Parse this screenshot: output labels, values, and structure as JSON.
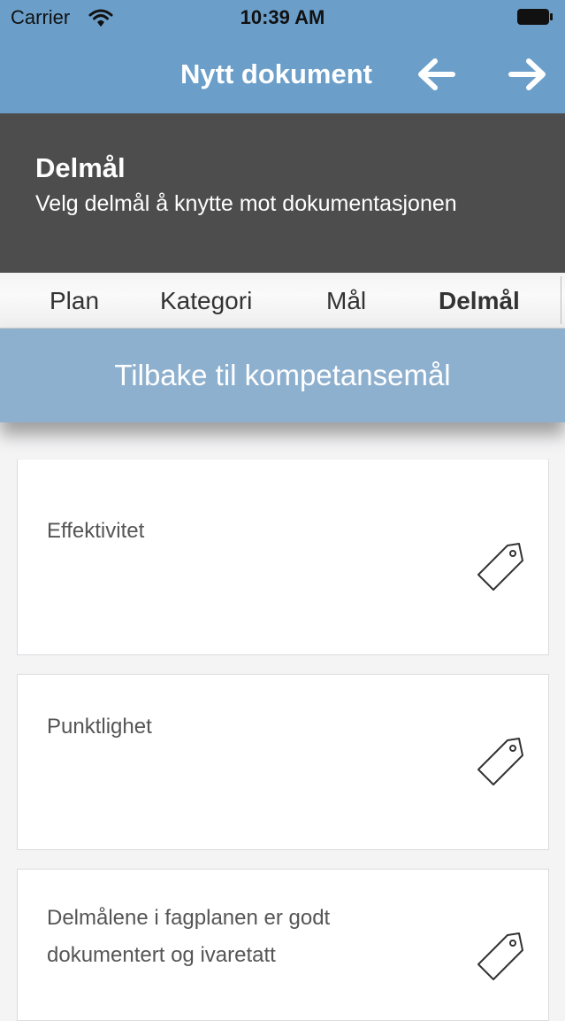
{
  "status_bar": {
    "carrier": "Carrier",
    "time": "10:39 AM"
  },
  "nav": {
    "title": "Nytt dokument",
    "back_icon": "arrow-left-icon",
    "forward_icon": "arrow-right-icon"
  },
  "header": {
    "title": "Delmål",
    "subtitle": "Velg delmål å knytte mot dokumentasjonen"
  },
  "tabs": [
    {
      "label": "Plan",
      "active": false
    },
    {
      "label": "Kategori",
      "active": false
    },
    {
      "label": "Mål",
      "active": false
    },
    {
      "label": "Delmål",
      "active": true
    }
  ],
  "back_banner": {
    "label": "Tilbake til kompetansemål"
  },
  "items": [
    {
      "label": "Effektivitet",
      "icon": "tag-icon"
    },
    {
      "label": "Punktlighet",
      "icon": "tag-icon"
    },
    {
      "label": "Delmålene i fagplanen er godt dokumentert og ivaretatt",
      "icon": "tag-icon"
    }
  ],
  "colors": {
    "nav_bg": "#6b9fca",
    "header_bg": "#4d4d4d",
    "banner_bg": "#8eb0cf",
    "list_bg": "#f4f4f5"
  }
}
